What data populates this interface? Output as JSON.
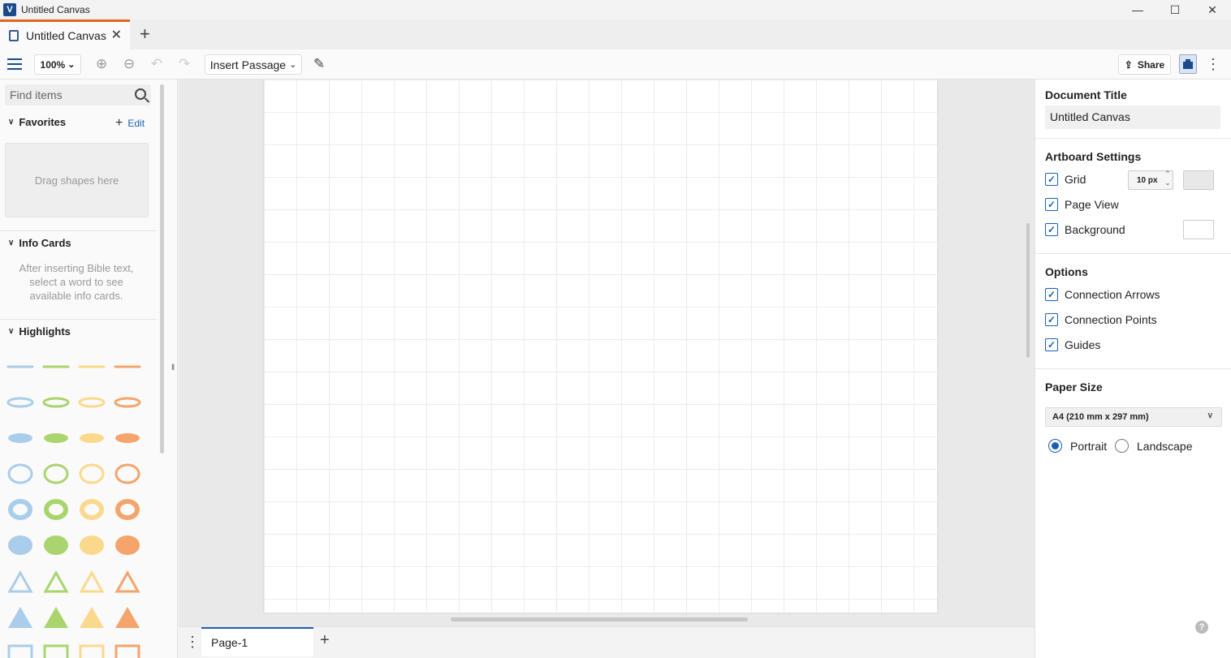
{
  "window": {
    "title": "Untitled Canvas",
    "minimize": "—",
    "maximize": "☐",
    "close": "✕"
  },
  "tabs": {
    "active_label": "Untitled Canvas",
    "close": "✕",
    "add": "+"
  },
  "toolbar": {
    "zoom": "100%",
    "zoom_chevron": "⌄",
    "zoom_in_icon": "⊕",
    "zoom_out_icon": "⊖",
    "undo_icon": "↶",
    "redo_icon": "↷",
    "insert_passage": "Insert Passage",
    "insert_chevron": "⌄",
    "pen_icon": "✎",
    "share_icon": "⇪",
    "share": "Share",
    "more": "⋮"
  },
  "sidebar": {
    "search_placeholder": "Find items",
    "favorites": {
      "title": "Favorites",
      "edit": "Edit",
      "add": "+",
      "dropzone": "Drag shapes here"
    },
    "info_cards": {
      "title": "Info Cards",
      "text": "After inserting Bible text, select a word to see available info cards."
    },
    "highlights": {
      "title": "Highlights",
      "colors": [
        "#a9cdea",
        "#a9d46e",
        "#fbd98c",
        "#f5a46b"
      ]
    }
  },
  "canvas": {
    "grid": true
  },
  "pagebar": {
    "more": "⋮",
    "page_label": "Page-1",
    "add": "+"
  },
  "right_panel": {
    "document_title_label": "Document Title",
    "document_title_value": "Untitled Canvas",
    "artboard_label": "Artboard Settings",
    "grid_label": "Grid",
    "grid_size": "10 px",
    "grid_color": "#e8e8e8",
    "page_view_label": "Page View",
    "background_label": "Background",
    "background_color": "#ffffff",
    "options_label": "Options",
    "connection_arrows": "Connection Arrows",
    "connection_points": "Connection Points",
    "guides": "Guides",
    "paper_size_label": "Paper Size",
    "paper_size_value": "A4 (210 mm x 297 mm)",
    "portrait": "Portrait",
    "landscape": "Landscape",
    "help": "?",
    "check": "✓"
  },
  "colors": {
    "accent": "#1a5fb4",
    "tab_accent": "#e8641b",
    "logo": "#1a4a8a"
  }
}
